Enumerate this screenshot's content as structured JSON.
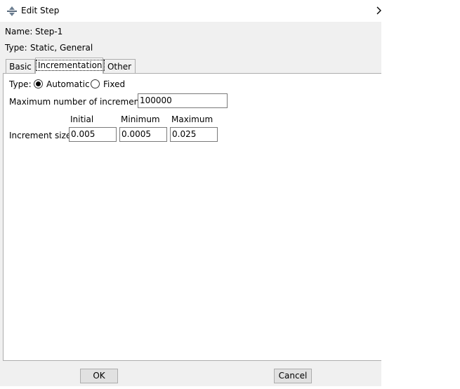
{
  "window": {
    "title": "Edit Step",
    "close_glyph": "›",
    "icon": "step-icon"
  },
  "info": {
    "name_label": "Name:",
    "name_value": "Step-1",
    "type_label": "Type:",
    "type_value": "Static, General"
  },
  "tabs": [
    {
      "label": "Basic",
      "active": false
    },
    {
      "label": "Incrementation",
      "active": true
    },
    {
      "label": "Other",
      "active": false
    }
  ],
  "incrementation": {
    "type_label": "Type:",
    "options": [
      {
        "label": "Automatic",
        "selected": true
      },
      {
        "label": "Fixed",
        "selected": false
      }
    ],
    "max_increments_label": "Maximum number of increments:",
    "max_increments_value": "100000",
    "col_headers": [
      "Initial",
      "Minimum",
      "Maximum"
    ],
    "increment_size_label": "Increment size:",
    "increment_values": [
      "0.005",
      "0.0005",
      "0.025"
    ]
  },
  "buttons": {
    "ok": "OK",
    "cancel": "Cancel"
  }
}
